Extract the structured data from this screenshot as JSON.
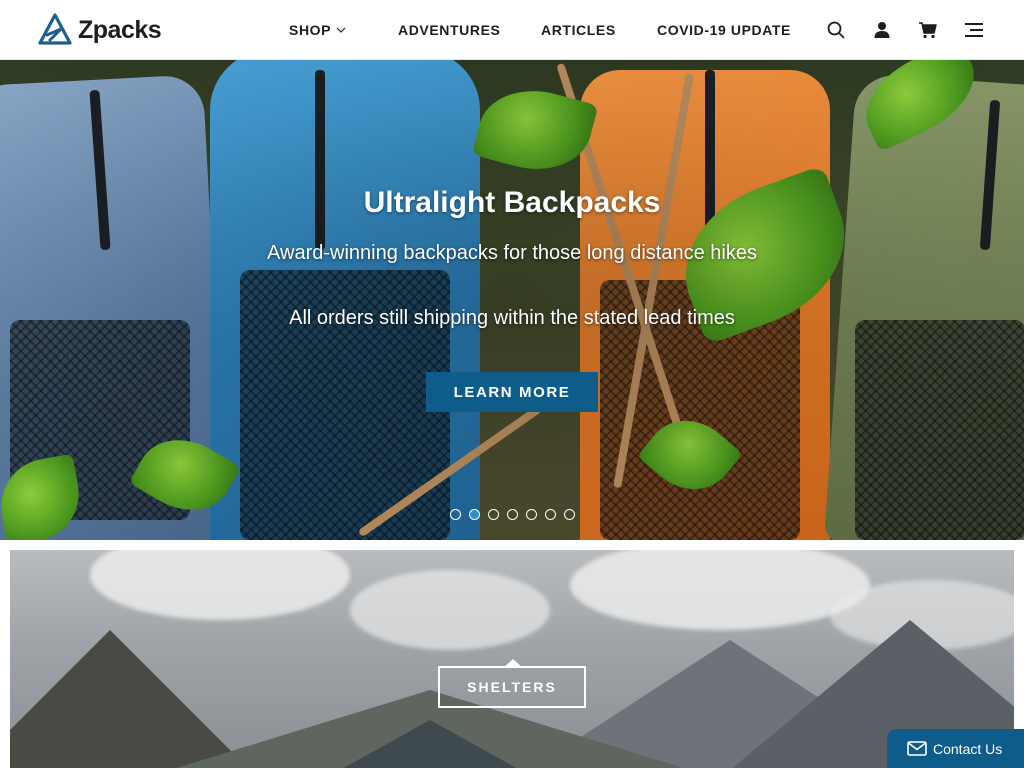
{
  "header": {
    "logo_text": "Zpacks",
    "nav": [
      {
        "label": "SHOP",
        "has_dropdown": true
      },
      {
        "label": "ADVENTURES"
      },
      {
        "label": "ARTICLES"
      },
      {
        "label": "COVID-19 UPDATE"
      }
    ],
    "icons": [
      "search-icon",
      "account-icon",
      "cart-icon",
      "menu-icon"
    ]
  },
  "hero": {
    "title": "Ultralight Backpacks",
    "subtitle": "Award-winning backpacks for those long distance hikes",
    "note": "All orders still shipping within the stated lead times",
    "button_label": "LEARN MORE",
    "slide_count": 7,
    "active_slide": 2
  },
  "category_banner": {
    "label": "SHELTERS"
  },
  "contact": {
    "label": "Contact Us"
  },
  "colors": {
    "brand_blue": "#0e5c8a",
    "dot_active": "#2a8fd0",
    "nav_text": "#1e1e1e"
  }
}
